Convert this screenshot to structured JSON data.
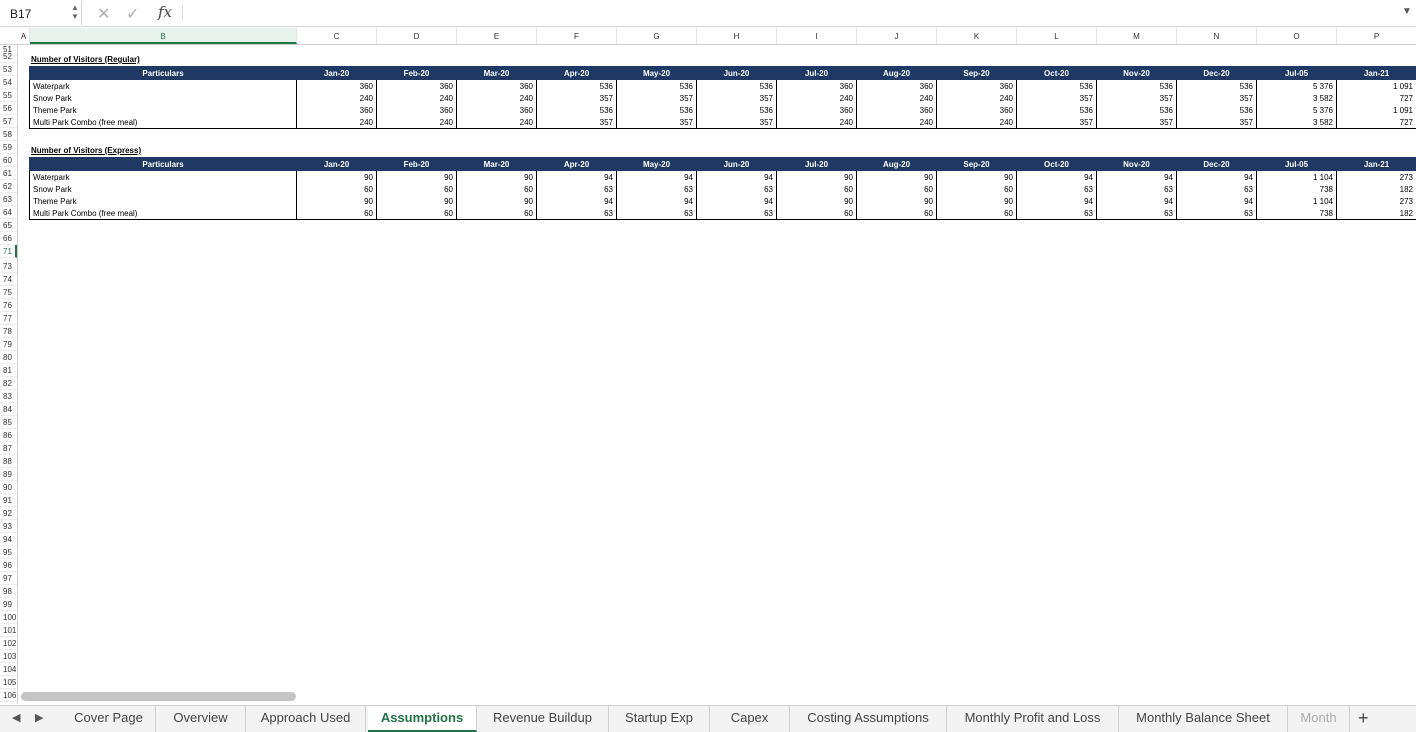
{
  "formula_bar": {
    "name_box": "B17",
    "cancel_glyph": "✕",
    "confirm_glyph": "✓",
    "fx_label": "fx",
    "formula": ""
  },
  "columns": [
    "A",
    "B",
    "C",
    "D",
    "E",
    "F",
    "G",
    "H",
    "I",
    "J",
    "K",
    "L",
    "M",
    "N",
    "O",
    "P"
  ],
  "selected_column": "B",
  "rows": [
    "51",
    "52",
    "53",
    "54",
    "55",
    "56",
    "57",
    "58",
    "59",
    "60",
    "61",
    "62",
    "63",
    "64",
    "65",
    "66",
    "71",
    "73",
    "74",
    "75",
    "76",
    "77",
    "78",
    "79",
    "80",
    "81",
    "82",
    "83",
    "84",
    "85",
    "86",
    "87",
    "88",
    "89",
    "90",
    "91",
    "92",
    "93",
    "94",
    "95",
    "96",
    "97",
    "98",
    "99",
    "100",
    "101",
    "102",
    "103",
    "104",
    "105",
    "106"
  ],
  "selected_row": "71",
  "sections": [
    {
      "title": "Number of Visitors (Regular)",
      "header_label": "Particulars",
      "months": [
        "Jan-20",
        "Feb-20",
        "Mar-20",
        "Apr-20",
        "May-20",
        "Jun-20",
        "Jul-20",
        "Aug-20",
        "Sep-20",
        "Oct-20",
        "Nov-20",
        "Dec-20",
        "Jul-05",
        "Jan-21"
      ],
      "rows": [
        {
          "label": "Waterpark",
          "values": [
            "360",
            "360",
            "360",
            "536",
            "536",
            "536",
            "360",
            "360",
            "360",
            "536",
            "536",
            "536",
            "5 376",
            "1 091"
          ]
        },
        {
          "label": "Snow Park",
          "values": [
            "240",
            "240",
            "240",
            "357",
            "357",
            "357",
            "240",
            "240",
            "240",
            "357",
            "357",
            "357",
            "3 582",
            "727"
          ]
        },
        {
          "label": "Theme Park",
          "values": [
            "360",
            "360",
            "360",
            "536",
            "536",
            "536",
            "360",
            "360",
            "360",
            "536",
            "536",
            "536",
            "5 376",
            "1 091"
          ]
        },
        {
          "label": "Multi Park Combo (free meal)",
          "values": [
            "240",
            "240",
            "240",
            "357",
            "357",
            "357",
            "240",
            "240",
            "240",
            "357",
            "357",
            "357",
            "3 582",
            "727"
          ]
        }
      ]
    },
    {
      "title": "Number of Visitors (Express)",
      "header_label": "Particulars",
      "months": [
        "Jan-20",
        "Feb-20",
        "Mar-20",
        "Apr-20",
        "May-20",
        "Jun-20",
        "Jul-20",
        "Aug-20",
        "Sep-20",
        "Oct-20",
        "Nov-20",
        "Dec-20",
        "Jul-05",
        "Jan-21"
      ],
      "rows": [
        {
          "label": "Waterpark",
          "values": [
            "90",
            "90",
            "90",
            "94",
            "94",
            "94",
            "90",
            "90",
            "90",
            "94",
            "94",
            "94",
            "1 104",
            "273"
          ]
        },
        {
          "label": "Snow Park",
          "values": [
            "60",
            "60",
            "60",
            "63",
            "63",
            "63",
            "60",
            "60",
            "60",
            "63",
            "63",
            "63",
            "738",
            "182"
          ]
        },
        {
          "label": "Theme Park",
          "values": [
            "90",
            "90",
            "90",
            "94",
            "94",
            "94",
            "90",
            "90",
            "90",
            "94",
            "94",
            "94",
            "1 104",
            "273"
          ]
        },
        {
          "label": "Multi Park Combo (free meal)",
          "values": [
            "60",
            "60",
            "60",
            "63",
            "63",
            "63",
            "60",
            "60",
            "60",
            "63",
            "63",
            "63",
            "738",
            "182"
          ]
        }
      ]
    }
  ],
  "sheet_tabs": {
    "nav_prev": "◀",
    "nav_next": "▶",
    "tabs": [
      "Cover Page",
      "Overview",
      "Approach Used",
      "Assumptions",
      "Revenue Buildup",
      "Startup Exp",
      "Capex",
      "Costing Assumptions",
      "Monthly Profit and Loss",
      "Monthly Balance Sheet",
      "Month"
    ],
    "active": "Assumptions",
    "add_label": "+"
  },
  "colors": {
    "header_fill": "#1f3864",
    "accent": "#217346"
  }
}
